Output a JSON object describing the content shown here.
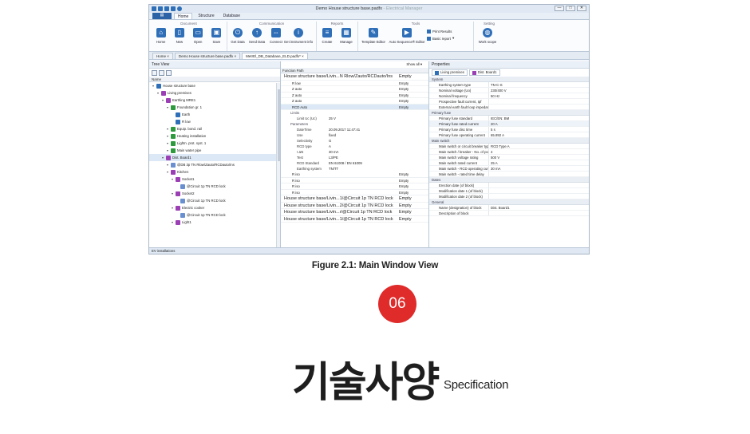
{
  "window": {
    "title": "Demo House structure base.padfx",
    "title_suffix": "- Electrical Manager",
    "controls": [
      "—",
      "□",
      "✕"
    ]
  },
  "ribbon_tabs": [
    "Home",
    "Structure",
    "Database"
  ],
  "ribbon_groups": [
    {
      "title": "Document",
      "buttons": [
        "Home",
        "New",
        "Open",
        "Save"
      ]
    },
    {
      "title": "Communication",
      "buttons": [
        "Get Data",
        "Send Data",
        "Connect",
        "Get instrument info"
      ]
    },
    {
      "title": "Reports",
      "buttons": [
        "Create",
        "Manage"
      ]
    },
    {
      "title": "Tools",
      "buttons": [
        "Template Editor",
        "Auto Sequence® Editor"
      ],
      "small": [
        "Print Results",
        "Basic report"
      ]
    },
    {
      "title": "Setting",
      "buttons": [
        "Work scope"
      ]
    }
  ],
  "doc_tabs": [
    "Home",
    "Demo House structure base.padfx",
    "MetrEl_DB_Database_ELD.padfx*"
  ],
  "tree_view": {
    "title": "Tree View",
    "column": "Name",
    "nodes": [
      {
        "label": "House structure base",
        "depth": 0
      },
      {
        "label": "Living premises",
        "depth": 1
      },
      {
        "label": "Earthing MRE1",
        "depth": 2
      },
      {
        "label": "Foundation gr. 1",
        "depth": 3
      },
      {
        "label": "Earth",
        "depth": 4
      },
      {
        "label": "R low",
        "depth": 4
      },
      {
        "label": "Equip. bond. rail",
        "depth": 3
      },
      {
        "label": "Heating installation",
        "depth": 3
      },
      {
        "label": "Lightn. prot. syst. 1",
        "depth": 3
      },
      {
        "label": "Main water pipe",
        "depth": 3
      },
      {
        "label": "Dist. Board1",
        "depth": 2
      },
      {
        "label": "@DB 3p TN Rlow/Zauto/RCDauto/Ins",
        "depth": 3
      },
      {
        "label": "Kitchen",
        "depth": 3
      },
      {
        "label": "Socket1",
        "depth": 4
      },
      {
        "label": "@Circuit 1p TN RCD lock",
        "depth": 5
      },
      {
        "label": "Socket2",
        "depth": 4
      },
      {
        "label": "@Circuit 1p TN RCD lock",
        "depth": 5
      },
      {
        "label": "Electric cooker",
        "depth": 4
      },
      {
        "label": "@Circuit 1p TN RCD lock",
        "depth": 5
      },
      {
        "label": "Light1",
        "depth": 4
      }
    ]
  },
  "function_path": {
    "toolbar": "Show all",
    "header": "Function Path",
    "rows": [
      {
        "name": "House structure base/Livin...N Rlow/Zauto/RCDauto/Ins",
        "value": "Empty",
        "big": true
      },
      {
        "name": "R low",
        "value": "Empty"
      },
      {
        "name": "Z auto",
        "value": "Empty"
      },
      {
        "name": "Z auto",
        "value": "Empty"
      },
      {
        "name": "Z auto",
        "value": "Empty"
      },
      {
        "name": "RCD Auto",
        "value": "Empty",
        "sel": true
      }
    ],
    "limits": {
      "title": "Limits",
      "items": [
        {
          "k": "Limit Uc  (Uc)",
          "v": "25 V"
        }
      ]
    },
    "parameters": {
      "title": "Parameters",
      "items": [
        {
          "k": "DateTime",
          "v": "20.09.2017 11:47:41"
        },
        {
          "k": "Use",
          "v": "fixed"
        },
        {
          "k": "Selectivity",
          "v": "G"
        },
        {
          "k": "RCD type",
          "v": "A"
        },
        {
          "k": "I ΔN",
          "v": "30 mA"
        },
        {
          "k": "Test",
          "v": "L3/PE"
        },
        {
          "k": "RCD Standard",
          "v": "EN 61008 / EN 61009"
        },
        {
          "k": "Earthing system",
          "v": "TN/TT"
        }
      ]
    },
    "rows_after": [
      {
        "name": "R iso",
        "value": "Empty"
      },
      {
        "name": "R iso",
        "value": "Empty"
      },
      {
        "name": "R iso",
        "value": "Empty"
      },
      {
        "name": "R iso",
        "value": "Empty"
      },
      {
        "name": "House structure base/Livin...1/@Circuit 1p TN RCD lock",
        "value": "Empty",
        "big": true
      },
      {
        "name": "House structure base/Livin...2/@Circuit 1p TN RCD lock",
        "value": "Empty",
        "big": true
      },
      {
        "name": "House structure base/Livin...r/@Circuit 1p TN RCD lock",
        "value": "Empty",
        "big": true
      },
      {
        "name": "House structure base/Livin...1/@Circuit 1p TN RCD lock",
        "value": "Empty",
        "big": true
      }
    ]
  },
  "properties": {
    "title": "Properties",
    "tabs": [
      "Living premises",
      "Dist. Board1"
    ],
    "groups": [
      {
        "title": "System",
        "rows": [
          {
            "k": "Earthing system type",
            "v": "TN-C-S"
          },
          {
            "k": "Nominal voltage (Uo)",
            "v": "230/400 V"
          },
          {
            "k": "Nominal frequency",
            "v": "50 Hz"
          },
          {
            "k": "Prospective fault current, Ipf",
            "v": ""
          },
          {
            "k": "External earth fault loop impedanc...",
            "v": ""
          }
        ]
      },
      {
        "title": "Primary fuse",
        "rows": [
          {
            "k": "Primary fuse standard",
            "v": "IEC/EN: BM"
          },
          {
            "k": "Primary fuse rated current",
            "v": "20 A"
          },
          {
            "k": "Primary fuse disc time",
            "v": "5 s"
          },
          {
            "k": "Primary fuse operating current",
            "v": "65.892 A"
          }
        ]
      },
      {
        "title": "Main switch",
        "rows": [
          {
            "k": "Main switch or circuit breaker type",
            "v": "RCD Type A"
          },
          {
            "k": "Main switch / breaker - No. of poles",
            "v": "4"
          },
          {
            "k": "Main switch voltage rating",
            "v": "500 V"
          },
          {
            "k": "Main switch rated current",
            "v": "25 A"
          },
          {
            "k": "Main switch - RCD operating curr...",
            "v": "30 mA"
          },
          {
            "k": "Main switch - rated time delay",
            "v": ""
          }
        ]
      },
      {
        "title": "Dates",
        "rows": [
          {
            "k": "Erection date (of block)",
            "v": ""
          },
          {
            "k": "Modification date 1 (of block)",
            "v": ""
          },
          {
            "k": "Modification date 2 (of block)",
            "v": ""
          }
        ]
      },
      {
        "title": "General",
        "rows": [
          {
            "k": "Name (designation) of block",
            "v": "Dist. Board1"
          },
          {
            "k": "Description of block",
            "v": ""
          }
        ]
      }
    ]
  },
  "statusbar": "EV installations",
  "caption": "Figure 2.1: Main Window View",
  "badge": "06",
  "heading": "기술사양",
  "heading_en": "Specification"
}
